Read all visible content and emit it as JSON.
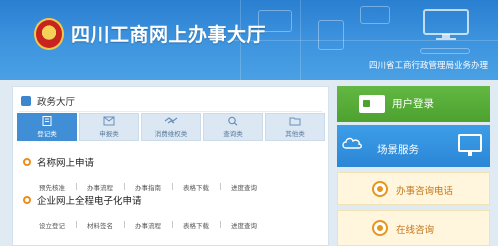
{
  "header": {
    "title": "四川工商网上办事大厅",
    "subtitle": "四川省工商行政管理局业务办理"
  },
  "panel": {
    "title": "政务大厅",
    "tabs": [
      {
        "label": "登记类",
        "icon": "document-icon",
        "active": true
      },
      {
        "label": "申报类",
        "icon": "mail-icon",
        "active": false
      },
      {
        "label": "消费维权类",
        "icon": "handshake-icon",
        "active": false
      },
      {
        "label": "查询类",
        "icon": "search-icon",
        "active": false
      },
      {
        "label": "其他类",
        "icon": "folder-icon",
        "active": false
      }
    ],
    "sections": [
      {
        "title": "名称网上申请",
        "links": [
          "预先核准",
          "办事流程",
          "办事指南",
          "表格下载",
          "进度查询"
        ]
      },
      {
        "title": "企业网上全程电子化申请",
        "links": [
          "设立登记",
          "材料签名",
          "办事流程",
          "表格下载",
          "进度查询"
        ]
      }
    ]
  },
  "right": {
    "login": "用户登录",
    "scene": "场景服务",
    "consult": "办事咨询电话",
    "online": "在线咨询"
  },
  "colors": {
    "header_blue": "#3e95df",
    "tab_active": "#3f8ed6",
    "login_green": "#4da12f",
    "scene_blue": "#2b86d6",
    "accent_orange": "#e6951e"
  }
}
